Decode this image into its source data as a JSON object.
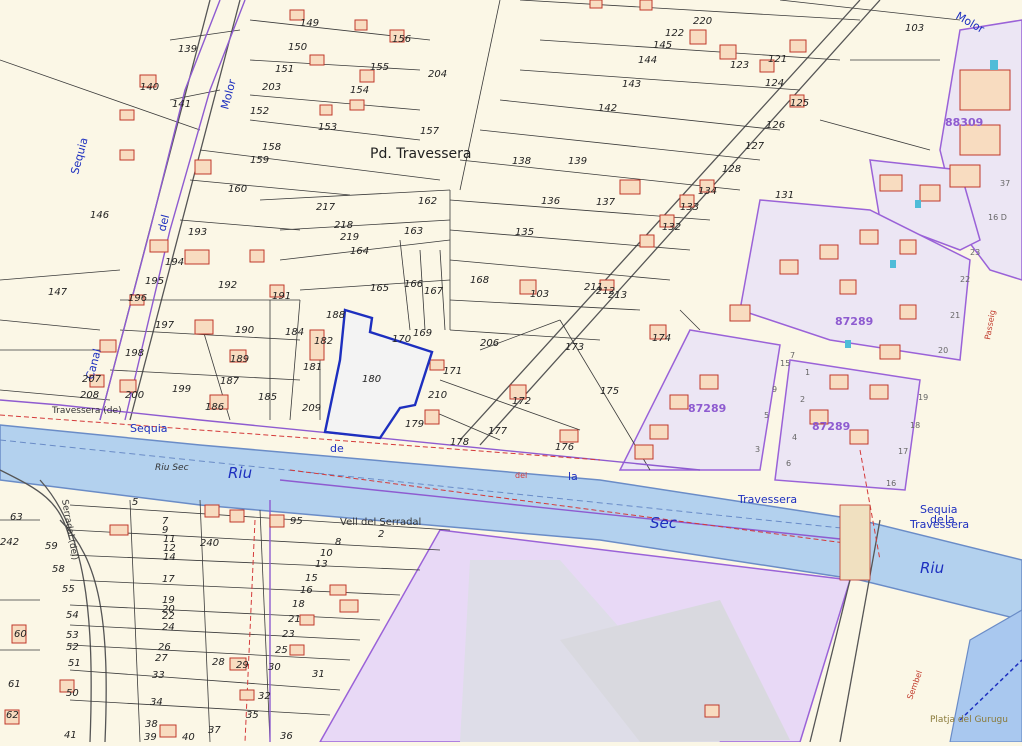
{
  "map": {
    "colors": {
      "background": "#fbf7e6",
      "parcel_line": "#3a3a3a",
      "building_fill": "#f8dcc0",
      "building_stroke": "#c0392b",
      "water_fill": "#b3d1ee",
      "water_stroke": "#6a8cc7",
      "highlight": "#1d2fbf",
      "purple_zone": "#eadcf5",
      "purple_stroke": "#9a62d8",
      "grey_block": "#e6e6ee"
    },
    "place_labels": {
      "pd_travessera": "Pd. Travessera",
      "riu_1": "Riu",
      "sec_1": "Sec",
      "riu_sec_small": "Riu Sec",
      "riu_2": "Riu",
      "sequia_1": "Sequia",
      "de_1": "de",
      "la_1": "la",
      "del_1": "del",
      "travessera_1": "Travessera",
      "sequia_2": "Sequia",
      "de_2": "de",
      "la_2": "la",
      "travessera_2": "Travessera",
      "sequia_left": "Sequia",
      "del_left": "del",
      "camal_left": "Canal",
      "molor_top": "Molor",
      "molor_right": "Molor",
      "vell_serradal": "Vell del Serradal",
      "serradal_del": "Serradal (del)",
      "travessera_del": "Travessera (de)",
      "platja": "Platja del Gurugu",
      "sembel": "Sembel",
      "passeig": "Passeig"
    },
    "block_ids": [
      "88309",
      "87289",
      "87289",
      "87289"
    ],
    "parcels": [
      "103",
      "139",
      "149",
      "156",
      "150",
      "151",
      "155",
      "204",
      "203",
      "154",
      "152",
      "153",
      "157",
      "158",
      "159",
      "140",
      "141",
      "142",
      "143",
      "144",
      "145",
      "146",
      "147",
      "160",
      "217",
      "218",
      "219",
      "162",
      "163",
      "164",
      "165",
      "166",
      "167",
      "168",
      "103",
      "193",
      "194",
      "195",
      "196",
      "197",
      "190",
      "184",
      "191",
      "192",
      "188",
      "182",
      "181",
      "189",
      "187",
      "185",
      "186",
      "199",
      "200",
      "207",
      "208",
      "198",
      "209",
      "170",
      "180",
      "169",
      "171",
      "210",
      "179",
      "206",
      "173",
      "172",
      "175",
      "176",
      "177",
      "178",
      "174",
      "135",
      "136",
      "137",
      "134",
      "133",
      "132",
      "131",
      "128",
      "127",
      "126",
      "125",
      "124",
      "121",
      "122",
      "123",
      "220",
      "138",
      "139",
      "211",
      "212",
      "213",
      "5",
      "7",
      "9",
      "240",
      "8",
      "10",
      "11",
      "12",
      "13",
      "14",
      "15",
      "16",
      "17",
      "18",
      "19",
      "20",
      "21",
      "22",
      "23",
      "24",
      "25",
      "26",
      "27",
      "28",
      "29",
      "30",
      "31",
      "32",
      "33",
      "34",
      "35",
      "36",
      "37",
      "38",
      "39",
      "40",
      "41",
      "50",
      "51",
      "52",
      "53",
      "54",
      "55",
      "58",
      "59",
      "60",
      "61",
      "62",
      "63",
      "242",
      "95",
      "2",
      "1"
    ],
    "street_numbers": [
      "37",
      "16 D",
      "23",
      "22",
      "21",
      "20",
      "19",
      "18",
      "17",
      "16",
      "15",
      "9",
      "7",
      "5",
      "3",
      "1",
      "2",
      "4",
      "6",
      "8"
    ]
  }
}
